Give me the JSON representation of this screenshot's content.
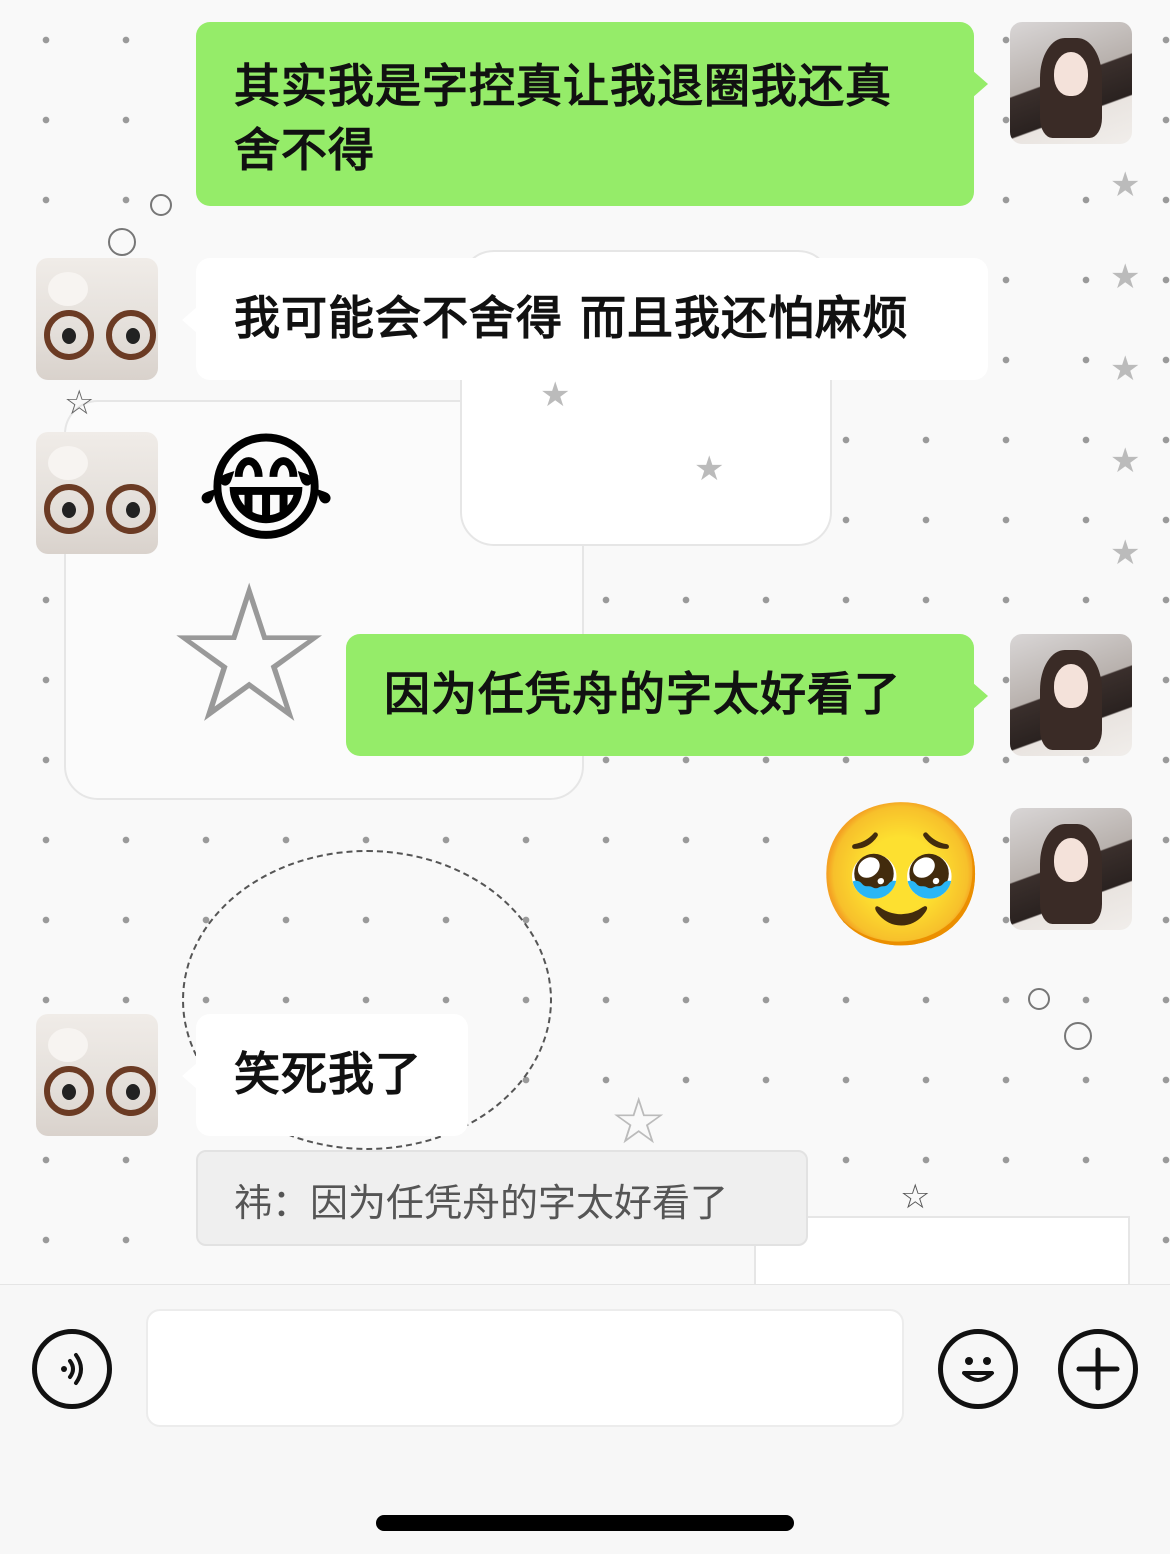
{
  "messages": [
    {
      "text": "其实我是字控真让我退圈我还真舍不得",
      "sender": "me"
    },
    {
      "text": "我可能会不舍得 而且我还怕麻烦",
      "sender": "other"
    },
    {
      "emoji": "😂",
      "sender": "other"
    },
    {
      "text": "因为任凭舟的字太好看了",
      "sender": "me"
    },
    {
      "emoji": "🥹",
      "sender": "me"
    },
    {
      "text": "笑死我了",
      "sender": "other"
    }
  ],
  "quote": {
    "text": "祎：因为任凭舟的字太好看了"
  },
  "input_bar": {
    "voice_icon": "voice-icon",
    "emoji_icon": "emoji-icon",
    "plus_icon": "plus-icon",
    "message_value": ""
  },
  "colors": {
    "sent_bubble": "#95ec69",
    "received_bubble": "#ffffff",
    "bar": "#f7f7f7"
  }
}
